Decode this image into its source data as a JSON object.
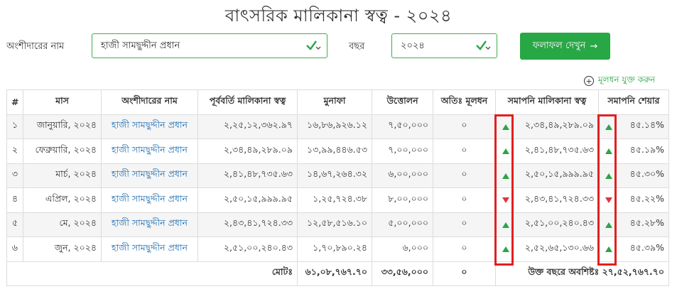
{
  "page": {
    "title": "বাৎসরিক মালিকানা স্বত্ব - ২০২৪"
  },
  "form": {
    "shareholder_label": "অংশীদারের নাম",
    "shareholder_value": "হাজী সামছুদ্দীন প্রধান",
    "year_label": "বছর",
    "year_value": "২০২৪",
    "submit_label": "ফলাফল দেখুন"
  },
  "add_capital_label": "মূলধন যুক্ত করুন",
  "colors": {
    "accent": "#28a745",
    "link": "#1f6fb2",
    "up": "#28a745",
    "down": "#dc3545",
    "highlight": "#e02020"
  },
  "table": {
    "headers": [
      "#",
      "মাস",
      "অংশীদারের নাম",
      "পূর্ববর্তি মালিকানা স্বত্ব",
      "মুনাফা",
      "উত্তোলন",
      "অতিঃ মূলধন",
      "সমাপনি মালিকানা স্বত্ব",
      "সমাপনি শেয়ার"
    ],
    "rows": [
      {
        "no": "১",
        "month": "জানুয়ারি, ২০২৪",
        "name": "হাজী সামছুদ্দীন প্রধান",
        "prev": "২,২৫,১২,৩৬২.৯৭",
        "profit": "১৬,৮৬,৯২৬.১২",
        "withdraw": "৭,৫০,০০০",
        "extra": "০",
        "closing_trend": "up",
        "closing": "২,৩৪,৪৯,২৮৯.০৯",
        "share_trend": "up",
        "share": "৪৫.১৪%"
      },
      {
        "no": "২",
        "month": "ফেব্রুয়ারি, ২০২৪",
        "name": "হাজী সামছুদ্দীন প্রধান",
        "prev": "২,৩৪,৪৯,২৮৯.০৯",
        "profit": "১৩,৯৯,৪৪৬.৫৩",
        "withdraw": "৭,০০,০০০",
        "extra": "০",
        "closing_trend": "up",
        "closing": "২,৪১,৪৮,৭৩৫.৬৩",
        "share_trend": "up",
        "share": "৪৫.১৯%"
      },
      {
        "no": "৩",
        "month": "মার্চ, ২০২৪",
        "name": "হাজী সামছুদ্দীন প্রধান",
        "prev": "২,৪১,৪৮,৭৩৫.৬৩",
        "profit": "১৪,৬৭,২৬৪.৩২",
        "withdraw": "৬,০০,০০০",
        "extra": "০",
        "closing_trend": "up",
        "closing": "২,৫০,১৫,৯৯৯.৯৫",
        "share_trend": "up",
        "share": "৪৫.৩০%"
      },
      {
        "no": "৪",
        "month": "এপ্রিল, ২০২৪",
        "name": "হাজী সামছুদ্দীন প্রধান",
        "prev": "২,৫০,১৫,৯৯৯.৯৫",
        "profit": "১,২৫,৭২৪.৩৮",
        "withdraw": "৮,০০,০০০",
        "extra": "০",
        "closing_trend": "down",
        "closing": "২,৪৩,৪১,৭২৪.৩৩",
        "share_trend": "down",
        "share": "৪৫.২২%"
      },
      {
        "no": "৫",
        "month": "মে, ২০২৪",
        "name": "হাজী সামছুদ্দীন প্রধান",
        "prev": "২,৪৩,৪১,৭২৪.৩৩",
        "profit": "১২,৫৮,৫১৬.১০",
        "withdraw": "৫,০০,০০০",
        "extra": "০",
        "closing_trend": "up",
        "closing": "২,৫১,০০,২৪০.৪৩",
        "share_trend": "up",
        "share": "৪৫.২৮%"
      },
      {
        "no": "৬",
        "month": "জুন, ২০২৪",
        "name": "হাজী সামছুদ্দীন প্রধান",
        "prev": "২,৫১,০০,২৪০.৪৩",
        "profit": "১,৭০,৮৯০.২৪",
        "withdraw": "৬,০০০",
        "extra": "০",
        "closing_trend": "up",
        "closing": "২,৫২,৬৫,১৩০.৬৬",
        "share_trend": "up",
        "share": "৪৫.৩৯%"
      }
    ],
    "footer": {
      "total_label": "মোটঃ",
      "total_profit": "৬১,০৮,৭৬৭.৭০",
      "total_withdraw": "৩৩,৫৬,০০০",
      "total_extra": "০",
      "remaining_label": "উক্ত বছরে অবশিষ্টঃ",
      "remaining_value": "২৭,৫২,৭৬৭.৭০"
    }
  }
}
